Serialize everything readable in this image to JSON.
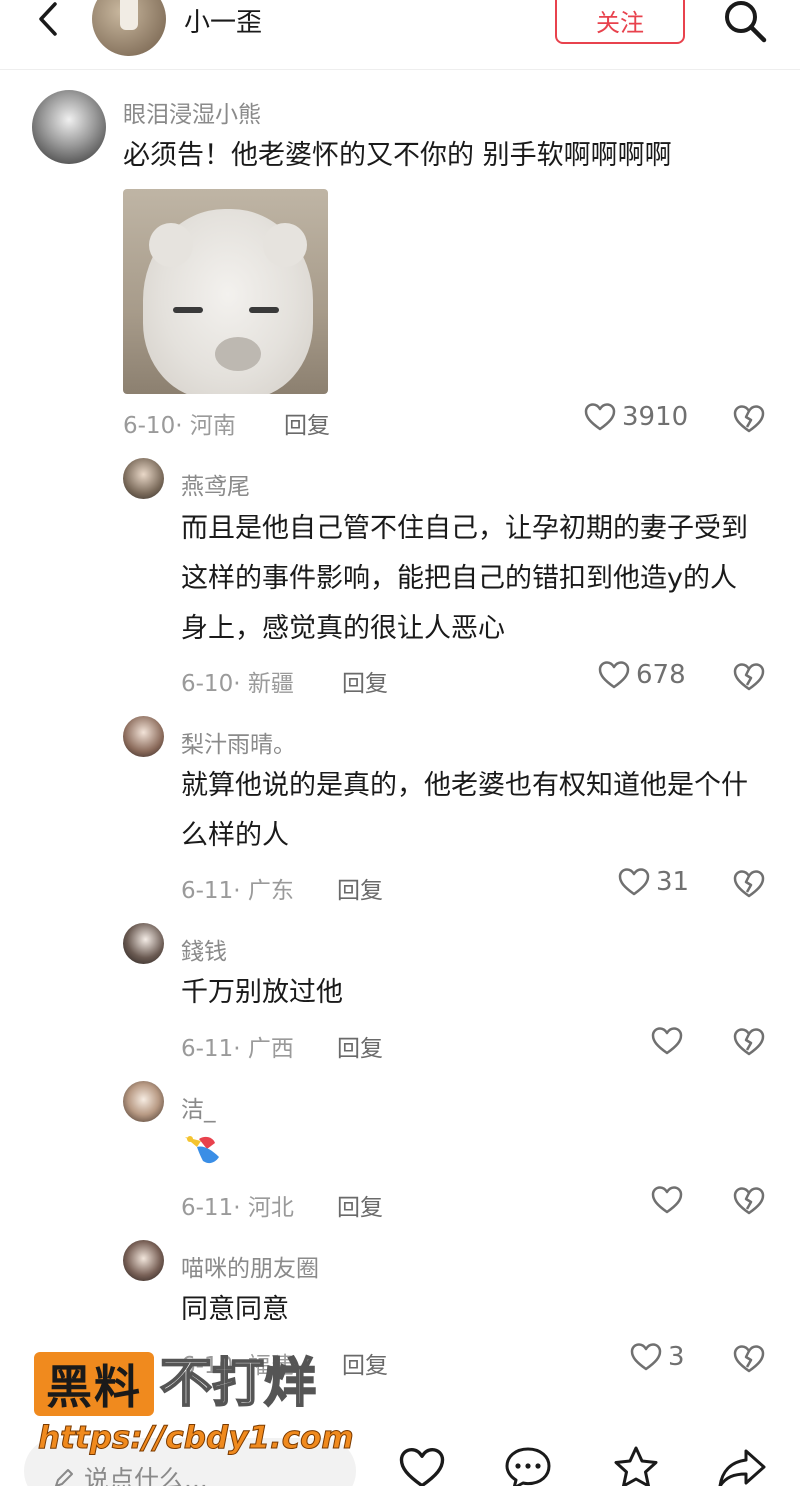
{
  "header": {
    "title": "小一歪",
    "follow_label": "关注"
  },
  "comments": [
    {
      "user": "眼泪浸湿小熊",
      "text": "必须告！他老婆怀的又不你的 别手软啊啊啊啊",
      "date_location": "6-10· 河南",
      "reply_label": "回复",
      "likes": "3910"
    },
    {
      "user": "燕鸢尾",
      "text": "而且是他自己管不住自己，让孕初期的妻子受到这样的事件影响，能把自己的错扣到他造y的人身上，感觉真的很让人恶心",
      "date_location": "6-10· 新疆",
      "reply_label": "回复",
      "likes": "678"
    },
    {
      "user": "梨汁雨晴。",
      "text": "就算他说的是真的，他老婆也有权知道他是个什么样的人",
      "date_location": "6-11· 广东",
      "reply_label": "回复",
      "likes": "31"
    },
    {
      "user": "錢钱",
      "text": "千万别放过他",
      "date_location": "6-11· 广西",
      "reply_label": "回复",
      "likes": ""
    },
    {
      "user": "洁_",
      "text": "",
      "date_location": "6-11· 河北",
      "reply_label": "回复",
      "likes": ""
    },
    {
      "user": "喵咪的朋友圈",
      "text": "同意同意",
      "date_location": "6-10· 福建",
      "reply_label": "回复",
      "likes": "3"
    }
  ],
  "watermark": {
    "badge": "黑料",
    "text": "不打烊",
    "url": "https://cbdy1.com"
  },
  "bottom_bar": {
    "input_placeholder": "说点什么..."
  },
  "colors": {
    "accent": "#e8424d",
    "watermark_orange": "#f08a1e"
  }
}
